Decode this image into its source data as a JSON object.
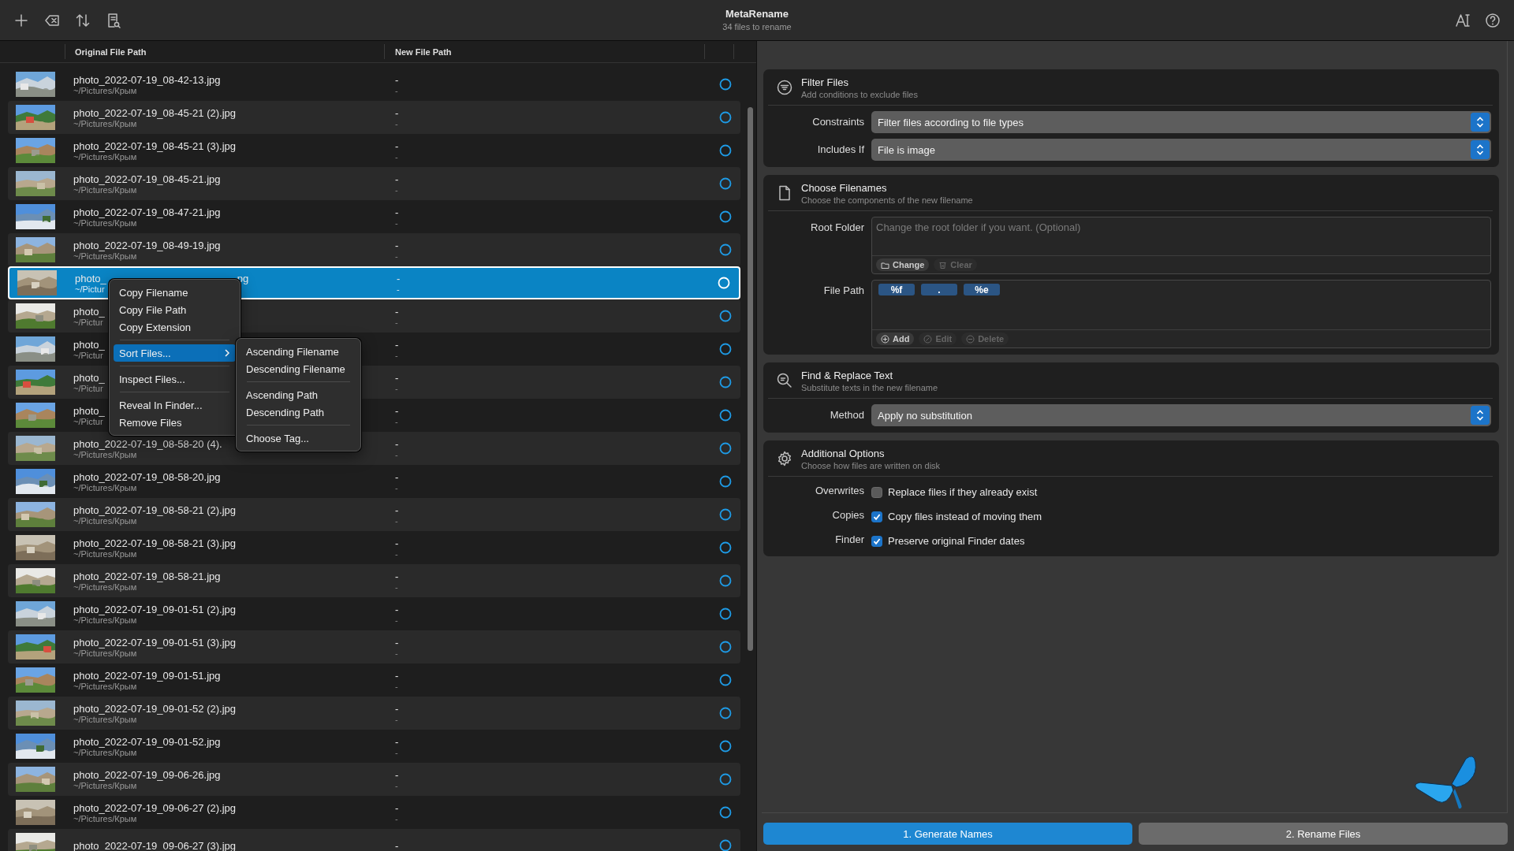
{
  "window": {
    "title": "MetaRename",
    "subtitle": "34 files to rename"
  },
  "table": {
    "columns": [
      "Original File Path",
      "New File Path"
    ],
    "rows": [
      {
        "name": "photo_2022-07-19_08-42-13.jpg",
        "path": "~/Pictures/Крым",
        "new_name": "-",
        "new_path": "-",
        "selected": false
      },
      {
        "name": "photo_2022-07-19_08-45-21 (2).jpg",
        "path": "~/Pictures/Крым",
        "new_name": "-",
        "new_path": "-",
        "selected": false
      },
      {
        "name": "photo_2022-07-19_08-45-21 (3).jpg",
        "path": "~/Pictures/Крым",
        "new_name": "-",
        "new_path": "-",
        "selected": false
      },
      {
        "name": "photo_2022-07-19_08-45-21.jpg",
        "path": "~/Pictures/Крым",
        "new_name": "-",
        "new_path": "-",
        "selected": false
      },
      {
        "name": "photo_2022-07-19_08-47-21.jpg",
        "path": "~/Pictures/Крым",
        "new_name": "-",
        "new_path": "-",
        "selected": false
      },
      {
        "name": "photo_2022-07-19_08-49-19.jpg",
        "path": "~/Pictures/Крым",
        "new_name": "-",
        "new_path": "-",
        "selected": false
      },
      {
        "name": "photo_",
        "name_tail": "pg",
        "path": "~/Pictur",
        "new_name": "-",
        "new_path": "-",
        "selected": true
      },
      {
        "name": "photo_",
        "path": "~/Pictur",
        "new_name": "-",
        "new_path": "-",
        "selected": false
      },
      {
        "name": "photo_",
        "path": "~/Pictur",
        "new_name": "-",
        "new_path": "-",
        "selected": false
      },
      {
        "name": "photo_",
        "path": "~/Pictur",
        "new_name": "-",
        "new_path": "-",
        "selected": false
      },
      {
        "name": "photo_",
        "path": "~/Pictur",
        "new_name": "-",
        "new_path": "-",
        "selected": false
      },
      {
        "name": "photo_2022-07-19_08-58-20 (4).",
        "path": "~/Pictures/Крым",
        "new_name": "-",
        "new_path": "-",
        "selected": false
      },
      {
        "name": "photo_2022-07-19_08-58-20.jpg",
        "path": "~/Pictures/Крым",
        "new_name": "-",
        "new_path": "-",
        "selected": false
      },
      {
        "name": "photo_2022-07-19_08-58-21 (2).jpg",
        "path": "~/Pictures/Крым",
        "new_name": "-",
        "new_path": "-",
        "selected": false
      },
      {
        "name": "photo_2022-07-19_08-58-21 (3).jpg",
        "path": "~/Pictures/Крым",
        "new_name": "-",
        "new_path": "-",
        "selected": false
      },
      {
        "name": "photo_2022-07-19_08-58-21.jpg",
        "path": "~/Pictures/Крым",
        "new_name": "-",
        "new_path": "-",
        "selected": false
      },
      {
        "name": "photo_2022-07-19_09-01-51 (2).jpg",
        "path": "~/Pictures/Крым",
        "new_name": "-",
        "new_path": "-",
        "selected": false
      },
      {
        "name": "photo_2022-07-19_09-01-51 (3).jpg",
        "path": "~/Pictures/Крым",
        "new_name": "-",
        "new_path": "-",
        "selected": false
      },
      {
        "name": "photo_2022-07-19_09-01-51.jpg",
        "path": "~/Pictures/Крым",
        "new_name": "-",
        "new_path": "-",
        "selected": false
      },
      {
        "name": "photo_2022-07-19_09-01-52 (2).jpg",
        "path": "~/Pictures/Крым",
        "new_name": "-",
        "new_path": "-",
        "selected": false
      },
      {
        "name": "photo_2022-07-19_09-01-52.jpg",
        "path": "~/Pictures/Крым",
        "new_name": "-",
        "new_path": "-",
        "selected": false
      },
      {
        "name": "photo_2022-07-19_09-06-26.jpg",
        "path": "~/Pictures/Крым",
        "new_name": "-",
        "new_path": "-",
        "selected": false
      },
      {
        "name": "photo_2022-07-19_09-06-27 (2).jpg",
        "path": "~/Pictures/Крым",
        "new_name": "-",
        "new_path": "-",
        "selected": false
      },
      {
        "name": "photo_2022-07-19_09-06-27 (3).jpg",
        "new_name": "-",
        "selected": false
      }
    ]
  },
  "context_menu": {
    "items": [
      {
        "kind": "item",
        "label": "Copy Filename",
        "selected": false
      },
      {
        "kind": "item",
        "label": "Copy File Path",
        "selected": false
      },
      {
        "kind": "item",
        "label": "Copy Extension",
        "selected": false
      },
      {
        "kind": "separator"
      },
      {
        "kind": "submenu",
        "label": "Sort Files...",
        "selected": true
      },
      {
        "kind": "separator"
      },
      {
        "kind": "item",
        "label": "Inspect Files...",
        "selected": false
      },
      {
        "kind": "separator"
      },
      {
        "kind": "item",
        "label": "Reveal In Finder...",
        "selected": false
      },
      {
        "kind": "item",
        "label": "Remove Files",
        "selected": false
      }
    ],
    "submenu": [
      {
        "kind": "item",
        "label": "Ascending Filename",
        "selected": false
      },
      {
        "kind": "item",
        "label": "Descending Filename",
        "selected": false
      },
      {
        "kind": "separator"
      },
      {
        "kind": "item",
        "label": "Ascending Path",
        "selected": false
      },
      {
        "kind": "item",
        "label": "Descending Path",
        "selected": false
      },
      {
        "kind": "separator"
      },
      {
        "kind": "item",
        "label": "Choose Tag...",
        "selected": false
      }
    ]
  },
  "sections": [
    {
      "kind": "filter",
      "title": "Filter Files",
      "subtitle": "Add conditions to exclude files",
      "fields": [
        {
          "kind": "select",
          "label": "Constraints",
          "value": "Filter files according to file types"
        },
        {
          "kind": "select",
          "label": "Includes If",
          "value": "File is image"
        }
      ]
    },
    {
      "kind": "document",
      "title": "Choose Filenames",
      "subtitle": "Choose the components of the new filename",
      "fields": [
        {
          "kind": "folder",
          "label": "Root Folder",
          "placeholder": "Change the root folder if you want. (Optional)",
          "buttons": [
            {
              "kind": "folder",
              "label": "Change",
              "disabled": false
            },
            {
              "kind": "trash",
              "label": "Clear",
              "disabled": true
            }
          ]
        },
        {
          "kind": "tokens",
          "label": "File Path",
          "tokens": [
            "%f",
            ".",
            "%e"
          ],
          "buttons": [
            {
              "kind": "add",
              "label": "Add",
              "disabled": false
            },
            {
              "kind": "edit",
              "label": "Edit",
              "disabled": true
            },
            {
              "kind": "delete",
              "label": "Delete",
              "disabled": true
            }
          ]
        }
      ]
    },
    {
      "kind": "search",
      "title": "Find & Replace Text",
      "subtitle": "Substitute texts in the new filename",
      "fields": [
        {
          "kind": "select",
          "label": "Method",
          "value": "Apply no substitution"
        }
      ]
    },
    {
      "kind": "gear",
      "title": "Additional Options",
      "subtitle": "Choose how files are written on disk",
      "fields": [
        {
          "kind": "checkbox",
          "label": "Overwrites",
          "text": "Replace files if they already exist",
          "checked": false
        },
        {
          "kind": "checkbox",
          "label": "Copies",
          "text": "Copy files instead of moving them",
          "checked": true
        },
        {
          "kind": "checkbox",
          "label": "Finder",
          "text": "Preserve original Finder dates",
          "checked": true
        }
      ]
    }
  ],
  "actions": [
    {
      "label": "1. Generate Names",
      "primary": true
    },
    {
      "label": "2. Rename Files",
      "primary": false
    }
  ]
}
